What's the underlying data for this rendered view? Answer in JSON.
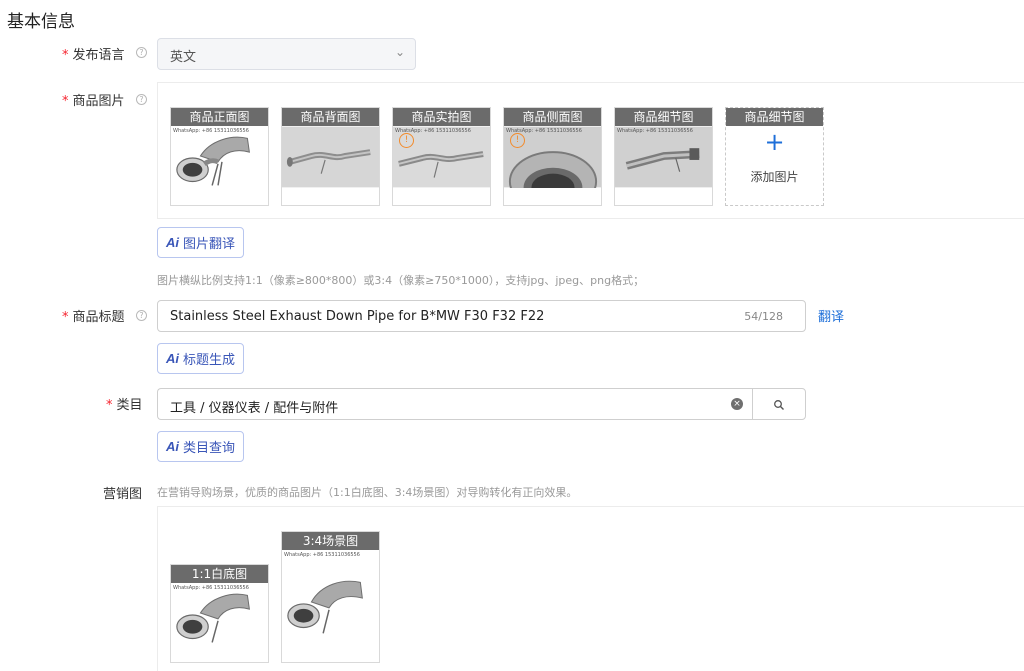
{
  "section_title": "基本信息",
  "language": {
    "label": "发布语言",
    "value": "英文"
  },
  "images": {
    "label": "商品图片",
    "tiles": [
      {
        "caption": "商品正面图",
        "watermark": "WhatsApp: +86 15311036556",
        "error": false
      },
      {
        "caption": "商品背面图",
        "watermark": "",
        "error": false
      },
      {
        "caption": "商品实拍图",
        "watermark": "WhatsApp: +86 15311036556",
        "error": true
      },
      {
        "caption": "商品侧面图",
        "watermark": "WhatsApp: +86 15311036556",
        "error": true
      },
      {
        "caption": "商品细节图",
        "watermark": "WhatsApp: +86 15311036556",
        "error": false
      }
    ],
    "add_tile": {
      "caption": "商品细节图",
      "text": "添加图片"
    },
    "error_glyph": "!",
    "translate_button": "图片翻译",
    "hint": "图片横纵比例支持1:1（像素≥800*800）或3:4（像素≥750*1000），支持jpg、jpeg、png格式；"
  },
  "title": {
    "label": "商品标题",
    "value": "Stainless Steel Exhaust Down Pipe for B*MW F30 F32 F22",
    "count": "54/128",
    "translate_link": "翻译",
    "generate_button": "标题生成"
  },
  "category": {
    "label": "类目",
    "value": "工具 / 仪器仪表 / 配件与附件",
    "query_button": "类目查询"
  },
  "marketing": {
    "label": "营销图",
    "hint": "在营销导购场景，优质的商品图片（1:1白底图、3:4场景图）对导购转化有正向效果。",
    "tiles": [
      {
        "caption": "1:1白底图",
        "watermark": "WhatsApp: +86 15311036556"
      },
      {
        "caption": "3:4场景图",
        "watermark": "WhatsApp: +86 15311036556"
      }
    ]
  },
  "ui": {
    "required_mark": "*",
    "help_glyph": "?",
    "ai_glyph": "Ai",
    "plus_glyph": "+",
    "clear_glyph": "×",
    "chevron_glyph": "⌄"
  },
  "colors": {
    "accent": "#1e6fd9",
    "ai": "#3a56b8",
    "required": "#f5222d",
    "warning": "#f28b2c",
    "caption_bg": "#6b6b6b"
  }
}
